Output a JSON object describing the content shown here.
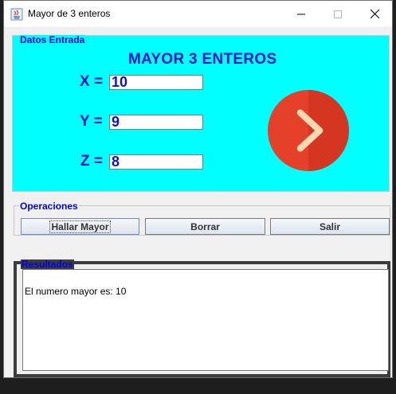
{
  "window": {
    "title": "Mayor de 3 enteros"
  },
  "entrada": {
    "legend": "Datos Entrada",
    "heading": "MAYOR 3 ENTEROS",
    "fields": [
      {
        "label": "X =",
        "value": "10"
      },
      {
        "label": "Y =",
        "value": "9"
      },
      {
        "label": "Z =",
        "value": "8"
      }
    ],
    "icon": "chevron-right-circle-icon"
  },
  "operaciones": {
    "legend": "Operaciones",
    "buttons": {
      "hallar": "Hallar Mayor",
      "borrar": "Borrar",
      "salir": "Salir"
    }
  },
  "resultados": {
    "legend": "Resultados",
    "text": "El numero mayor es: 10"
  },
  "colors": {
    "panel_bg": "#00ffff",
    "label_blue": "#0a14d2",
    "legend_blue": "#0000ee",
    "icon_red": "#e5402a"
  }
}
